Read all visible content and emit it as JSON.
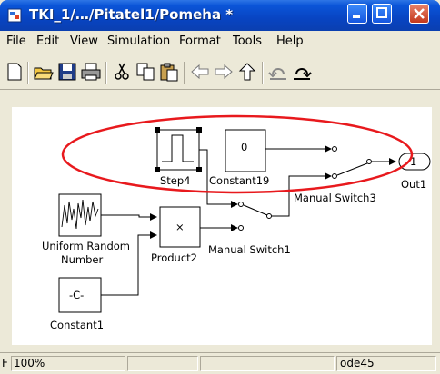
{
  "window": {
    "title": "TKI_1/…/Pitatel1/Pomeha *"
  },
  "menu": [
    "File",
    "Edit",
    "View",
    "Simulation",
    "Format",
    "Tools",
    "Help"
  ],
  "toolbar_icons": [
    "new-icon",
    "open-icon",
    "save-icon",
    "print-icon",
    "cut-icon",
    "copy-icon",
    "paste-icon",
    "back-icon",
    "forward-icon",
    "up-icon",
    "undo-icon",
    "redo-icon"
  ],
  "diagram": {
    "step": {
      "label": "Step4"
    },
    "constant19": {
      "label": "Constant19",
      "value": "0"
    },
    "out1": {
      "label": "Out1",
      "value": "1"
    },
    "switch3": {
      "label": "Manual Switch3"
    },
    "uniform": {
      "label_line1": "Uniform Random",
      "label_line2": "Number"
    },
    "product": {
      "label": "Product2",
      "symbol": "×"
    },
    "switch1": {
      "label": "Manual Switch1"
    },
    "constant1": {
      "label": "Constant1",
      "value": "-C-"
    },
    "highlight_color": "#e8191d"
  },
  "status": {
    "left_char": "F",
    "zoom": "100%",
    "solver": "ode45"
  }
}
